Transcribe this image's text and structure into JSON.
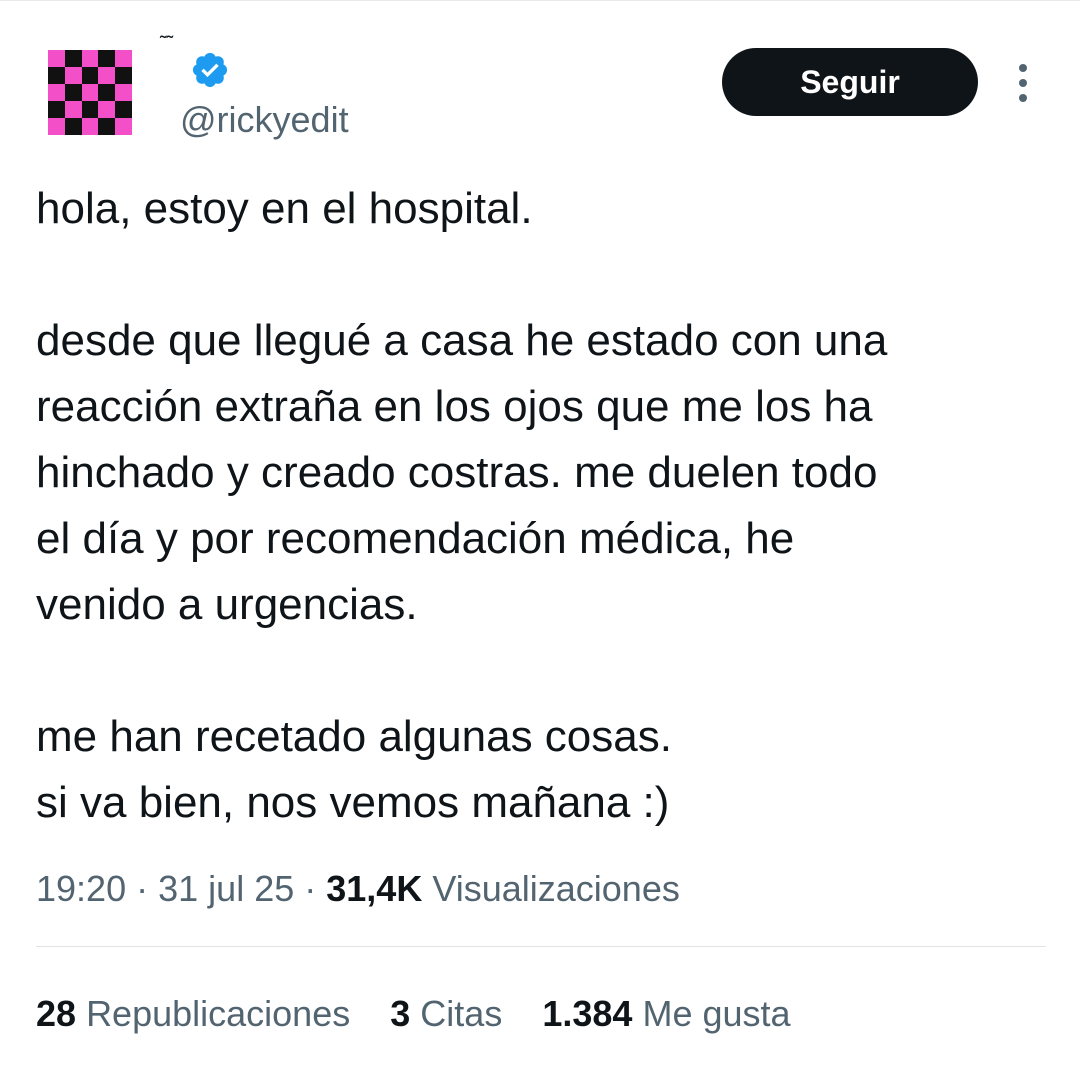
{
  "header": {
    "display_name": "˜˜",
    "handle": "@rickyedit",
    "verified_icon": "verified-badge-icon",
    "verified_color": "#1d9bf0",
    "follow_label": "Seguir",
    "more_icon": "more-vertical-icon"
  },
  "tweet": {
    "paragraphs": [
      [
        "hola, estoy en el hospital."
      ],
      [
        "desde que llegué a casa he estado con una",
        "reacción extraña en los ojos que me los ha",
        "hinchado y creado costras. me duelen todo",
        "el día y por recomendación médica, he",
        "venido a urgencias."
      ],
      [
        "me han recetado algunas cosas.",
        "si va bien, nos vemos mañana :)"
      ]
    ]
  },
  "meta": {
    "time": "19:20",
    "date": "31 jul 25",
    "views_count": "31,4K",
    "views_label": "Visualizaciones"
  },
  "stats": {
    "reposts_count": "28",
    "reposts_label": "Republicaciones",
    "quotes_count": "3",
    "quotes_label": "Citas",
    "likes_count": "1.384",
    "likes_label": "Me gusta"
  },
  "colors": {
    "text": "#0f1419",
    "secondary": "#536471",
    "avatar_pink": "#f24fc8",
    "avatar_black": "#111111"
  }
}
